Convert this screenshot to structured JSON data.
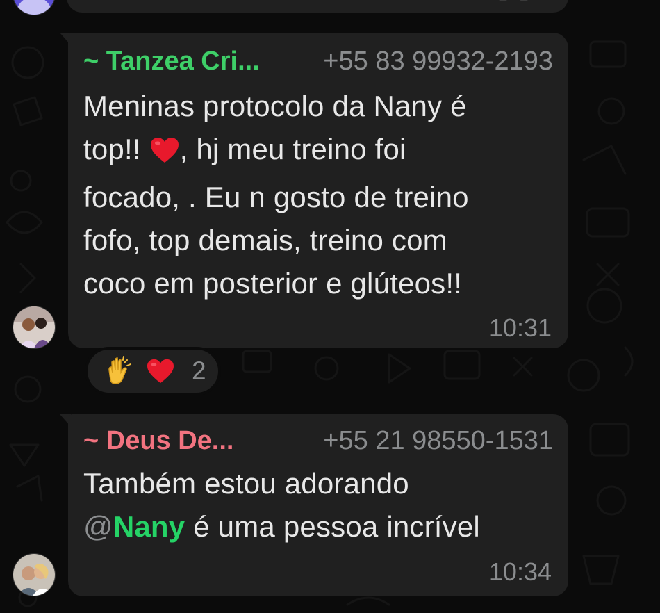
{
  "colors": {
    "background": "#0b0b0b",
    "bubble": "#202020",
    "sender_tanzea": "#3ecf68",
    "sender_deus": "#f27380",
    "mention": "#25d366",
    "meta": "#8b8d8f",
    "heart": "#e8192c"
  },
  "messages": [
    {
      "sender_name": "~ Tanzea Cri...",
      "phone": "+55 83 99932-2193",
      "lines": {
        "l1": "Meninas protocolo da  Nany é",
        "l2_pre": "top!! ",
        "l2_post": ", hj meu treino foi",
        "l3": "focado, . Eu n gosto de treino",
        "l4": "fofo, top demais,  treino com",
        "l5": "coco em posterior e glúteos!!"
      },
      "time": "10:31",
      "inline_icon": "red-heart-icon",
      "reactions": {
        "icons": [
          "clapping-hands-icon",
          "red-heart-icon"
        ],
        "count": "2"
      }
    },
    {
      "sender_name": "~ Deus De...",
      "phone": "+55 21 98550-1531",
      "lines": {
        "l1": "Também estou adorando",
        "mention_at": "@",
        "mention_name": "Nany",
        "l2_post": " é uma pessoa incrível"
      },
      "time": "10:34"
    }
  ]
}
